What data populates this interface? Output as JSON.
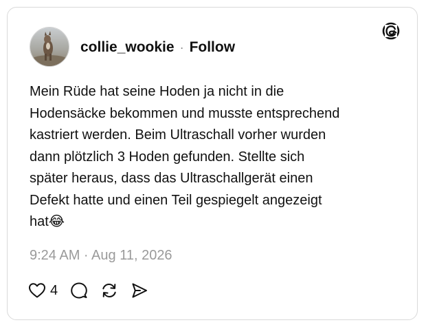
{
  "post": {
    "username": "collie_wookie",
    "separator": "·",
    "follow_label": "Follow",
    "text": "Mein Rüde hat seine Hoden ja nicht in die\nHodensäcke bekommen und musste entsprechend\nkastriert werden. Beim Ultraschall vorher wurden\ndann plötzlich 3 Hoden gefunden. Stellte sich\nspäter heraus, dass das Ultraschallgerät einen\nDefekt hatte und einen Teil gespiegelt angezeigt\nhat😂",
    "timestamp": "9:24 AM · Aug 11, 2026",
    "like_count": "4"
  },
  "icons": {
    "brand": "threads-logo-icon",
    "like": "heart-icon",
    "reply": "comment-bubble-icon",
    "repost": "repost-icon",
    "share": "send-icon"
  },
  "colors": {
    "text": "#101010",
    "muted": "#9a9a9a",
    "border": "#d9d9d9"
  }
}
